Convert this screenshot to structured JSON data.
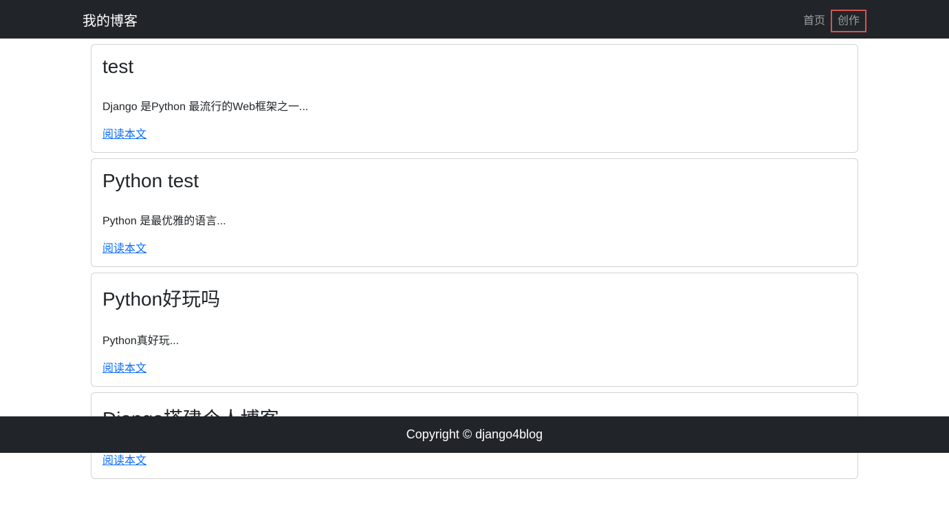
{
  "navbar": {
    "brand": "我的博客",
    "links": [
      {
        "label": "首页",
        "highlighted": false
      },
      {
        "label": "创作",
        "highlighted": true
      }
    ]
  },
  "posts": [
    {
      "title": "test",
      "excerpt": "Django 是Python 最流行的Web框架之一...",
      "read_more": "阅读本文"
    },
    {
      "title": "Python test",
      "excerpt": "Python 是最优雅的语言...",
      "read_more": "阅读本文"
    },
    {
      "title": "Python好玩吗",
      "excerpt": "Python真好玩...",
      "read_more": "阅读本文"
    },
    {
      "title": "Django搭建个人博客",
      "excerpt": "",
      "read_more": "阅读本文"
    }
  ],
  "footer": {
    "text": "Copyright © django4blog"
  }
}
